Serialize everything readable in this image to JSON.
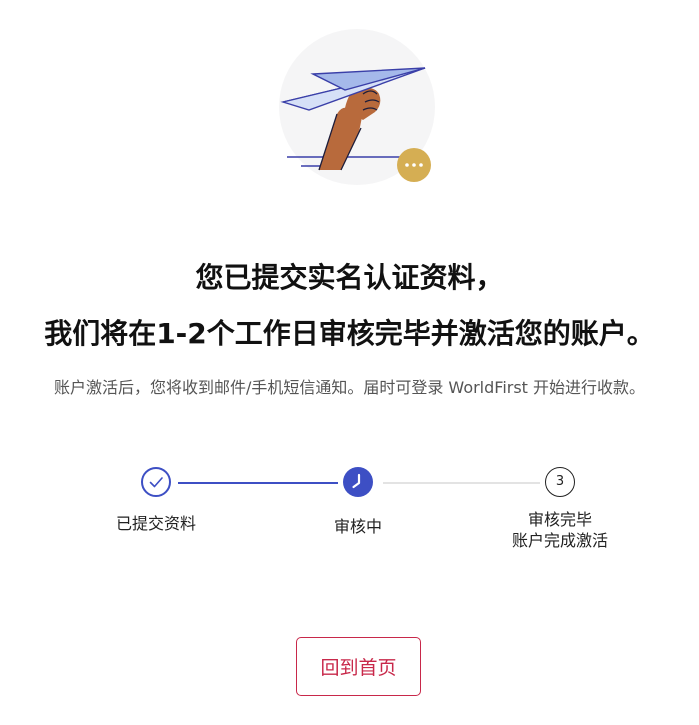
{
  "hero": {
    "icon": "paper-plane-hand-illustration",
    "pending_badge_icon": "ellipsis-icon",
    "circle_color": "#f5f5f6",
    "badge_color": "#d5ae53"
  },
  "heading": {
    "line1": "您已提交实名认证资料，",
    "line2": "我们将在1-2个工作日审核完毕并激活您的账户。"
  },
  "subtitle": "账户激活后，您将收到邮件/手机短信通知。届时可登录 WorldFirst 开始进行收款。",
  "progress": {
    "accent_color": "#3d4fc4",
    "steps": [
      {
        "label": "已提交资料",
        "status": "completed",
        "icon": "check-icon"
      },
      {
        "label": "审核中",
        "status": "in-progress",
        "icon": "clock-icon"
      },
      {
        "number": "3",
        "label_line1": "审核完毕",
        "label_line2": "账户完成激活",
        "status": "pending"
      }
    ]
  },
  "actions": {
    "home_button": "回到首页",
    "button_color": "#c8284a"
  }
}
